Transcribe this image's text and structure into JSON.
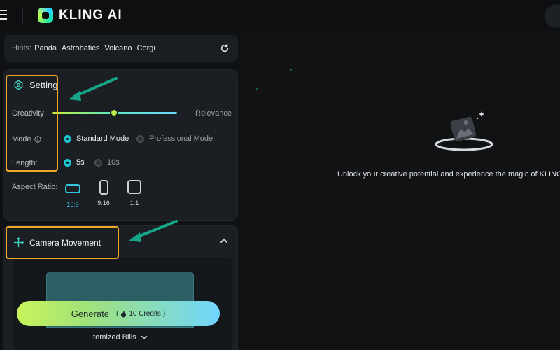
{
  "header": {
    "logo_text": "KLING AI"
  },
  "hints": {
    "label": "Hints:",
    "items": [
      "Panda",
      "Astrobatics",
      "Volcano",
      "Corgi"
    ]
  },
  "settings": {
    "title": "Setting",
    "creativity_label": "Creativity",
    "relevance_label": "Relevance",
    "slider_position": 0.5,
    "mode_label": "Mode",
    "mode_options": [
      "Standard Mode",
      "Professional Mode"
    ],
    "mode_selected": "Standard Mode",
    "length_label": "Length:",
    "length_options": [
      "5s",
      "10s"
    ],
    "length_selected": "5s",
    "aspect_label": "Aspect Ratio:",
    "aspect_options": [
      "16:9",
      "9:16",
      "1:1"
    ],
    "aspect_selected": "16:9"
  },
  "camera": {
    "title": "Camera Movement"
  },
  "generate": {
    "label": "Generate",
    "credits": "10 Credits"
  },
  "itemized": {
    "label": "Itemized Bills"
  },
  "main": {
    "empty_text": "Unlock your creative potential and experience the magic of KLING AI"
  },
  "colors": {
    "accent": "#1fc9d6",
    "annotation_box": "#f0a722",
    "annotation_arrow": "#17a589"
  }
}
